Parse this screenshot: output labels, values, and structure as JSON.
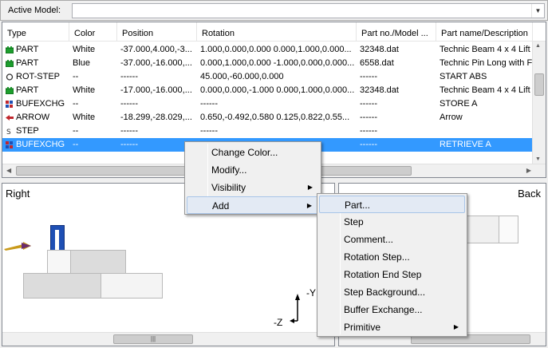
{
  "active_model": {
    "label": "Active Model:",
    "value": ""
  },
  "columns": [
    "Type",
    "Color",
    "Position",
    "Rotation",
    "Part no./Model ...",
    "Part name/Description"
  ],
  "rows": [
    {
      "type": "PART",
      "icon": "part-icon",
      "color": "White",
      "position": "-37.000,4.000,-3...",
      "rotation": "1.000,0.000,0.000 0.000,1.000,0.000...",
      "part_no": "32348.dat",
      "name": "Technic Beam  4 x  4 Lift"
    },
    {
      "type": "PART",
      "icon": "part-icon",
      "color": "Blue",
      "position": "-37.000,-16.000,...",
      "rotation": "0.000,1.000,0.000 -1.000,0.000,0.000...",
      "part_no": "6558.dat",
      "name": "Technic Pin Long with Fri"
    },
    {
      "type": "ROT-STEP",
      "icon": "rotstep-icon",
      "color": "--",
      "position": "------",
      "rotation": "45.000,-60.000,0.000",
      "part_no": "------",
      "name": "START ABS"
    },
    {
      "type": "PART",
      "icon": "part-icon",
      "color": "White",
      "position": "-17.000,-16.000,...",
      "rotation": "0.000,0.000,-1.000 0.000,1.000,0.000...",
      "part_no": "32348.dat",
      "name": "Technic Beam  4 x  4 Lift"
    },
    {
      "type": "BUFEXCHG",
      "icon": "bufexchg-icon",
      "color": "--",
      "position": "------",
      "rotation": "------",
      "part_no": "------",
      "name": "STORE A"
    },
    {
      "type": "ARROW",
      "icon": "arrow-icon",
      "color": "White",
      "position": "-18.299,-28.029,...",
      "rotation": "0.650,-0.492,0.580 0.125,0.822,0.55...",
      "part_no": "------",
      "name": "Arrow"
    },
    {
      "type": "STEP",
      "icon": "step-icon",
      "color": "--",
      "position": "------",
      "rotation": "------",
      "part_no": "------",
      "name": ""
    },
    {
      "type": "BUFEXCHG",
      "icon": "bufexchg-icon",
      "color": "--",
      "position": "------",
      "rotation": "",
      "part_no": "------",
      "name": "RETRIEVE A",
      "selected": true
    }
  ],
  "panes": {
    "right": "Right",
    "back": "Back"
  },
  "axis": {
    "y": "-Y",
    "z": "-Z"
  },
  "context_menu": {
    "items": [
      "Change Color...",
      "Modify...",
      "Visibility",
      "Add"
    ],
    "highlighted": "Add"
  },
  "add_submenu": {
    "items": [
      "Part...",
      "Step",
      "Comment...",
      "Rotation Step...",
      "Rotation End Step",
      "Step Background...",
      "Buffer Exchange...",
      "Primitive"
    ],
    "highlighted": "Part..."
  },
  "colors": {
    "selection": "#3399ff",
    "part_icon": "#1c9e2d",
    "blue_part": "#1e4fb4",
    "arrow": "#c99a1a"
  }
}
